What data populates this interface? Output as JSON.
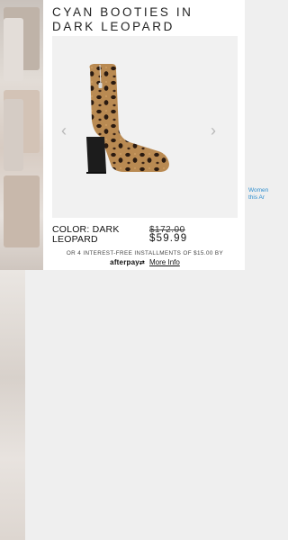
{
  "product": {
    "title_line1": "CYAN BOOTIES IN",
    "title_line2": "DARK LEOPARD",
    "color_label": "COLOR: DARK LEOPARD",
    "original_price": "$172.00",
    "sale_price": "$59.99"
  },
  "payment": {
    "installments_text": "OR 4 INTEREST-FREE INSTALLMENTS OF $15.00 BY",
    "provider": "afterpay",
    "more_info": "More Info"
  },
  "background": {
    "side_text_line1": "Women",
    "side_text_line2": "this Ar"
  },
  "colors": {
    "leopard_base": "#b98a52",
    "spot": "#2a1a10",
    "heel": "#1c1c1c",
    "link_blue": "#2f8ecf"
  }
}
